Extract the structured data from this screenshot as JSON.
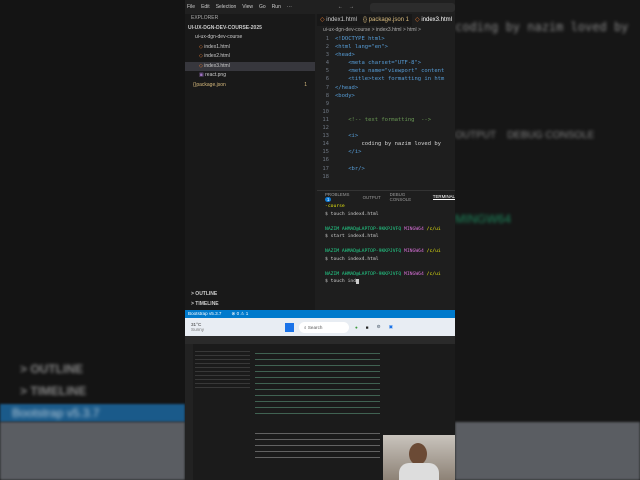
{
  "menu": [
    "File",
    "Edit",
    "Selection",
    "View",
    "Go",
    "Run",
    "···"
  ],
  "explorer": {
    "title": "EXPLORER",
    "root": "UI-UX-DGN-DEV-COURSE-2025",
    "folder": "ui-ux-dgn-dev-course",
    "files": [
      "index1.html",
      "index2.html",
      "index3.html",
      "react.png",
      "package.json"
    ],
    "package_badge": "1"
  },
  "tabs": [
    "index1.html",
    "package.json 1",
    "index3.html"
  ],
  "breadcrumb": "ui-ux-dgn-dev-course > index3.html > html >",
  "code": [
    "<!DOCTYPE html>",
    "<html lang=\"en\">",
    "<head>",
    "    <meta charset=\"UTF-8\">",
    "    <meta name=\"viewport\" content",
    "    <title>text formatting in htm",
    "</head>",
    "<body>",
    "",
    "",
    "    <!-- text formatting  -->",
    "",
    "    <i>",
    "        coding by nazim loved by",
    "    </i>",
    "",
    "    <br/>",
    ""
  ],
  "panel_tabs": {
    "problems": "PROBLEMS",
    "problems_count": "1",
    "output": "OUTPUT",
    "debug": "DEBUG CONSOLE",
    "terminal": "TERMINAL"
  },
  "terminal": {
    "l0": "-course",
    "c1": "$ touch index4.html",
    "prompt_user": "NAZIM AHMAD@LAPTOP-9KKPJVFQ",
    "prompt_shell": "MINGW64",
    "prompt_path": "/c/ui",
    "c2": "$ start index4.html",
    "c3": "$ touch index4.html",
    "c4": "$ touch ind"
  },
  "sidebar_sections": {
    "outline": "> OUTLINE",
    "timeline": "> TIMELINE"
  },
  "status": {
    "bootstrap": "Bootstrap v5.3.7",
    "problems": "⊗ 0 ⚠ 1"
  },
  "taskbar": {
    "weather_temp": "31°C",
    "weather_desc": "Sunny",
    "search": "Search"
  }
}
